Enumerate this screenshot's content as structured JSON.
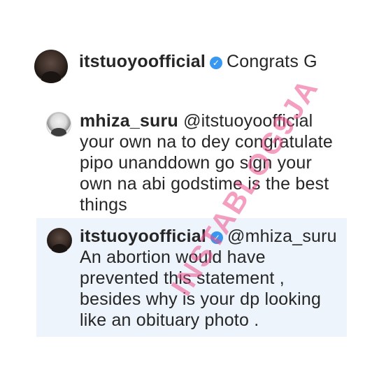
{
  "comments": [
    {
      "username": "itstuoyoofficial",
      "verified": true,
      "mention": "",
      "lines": [
        "Congrats G"
      ]
    },
    {
      "username": "mhiza_suru",
      "verified": false,
      "mention": "@itstuoyoofficial",
      "lines": [
        "your own na to dey congratulate",
        "pipo unanddown go sign your",
        "own na abi godstime is the best",
        "things"
      ]
    },
    {
      "username": "itstuoyoofficial",
      "verified": true,
      "mention": "@mhiza_suru",
      "lines": [
        "An abortion would have",
        "prevented this statement ,",
        "besides why is your dp looking",
        "like an obituary photo ."
      ]
    }
  ],
  "watermark": "INSTABLOG9JA",
  "colors": {
    "verified_badge": "#3897f0",
    "reply_highlight": "#eef4fb",
    "watermark": "#eb508c"
  }
}
